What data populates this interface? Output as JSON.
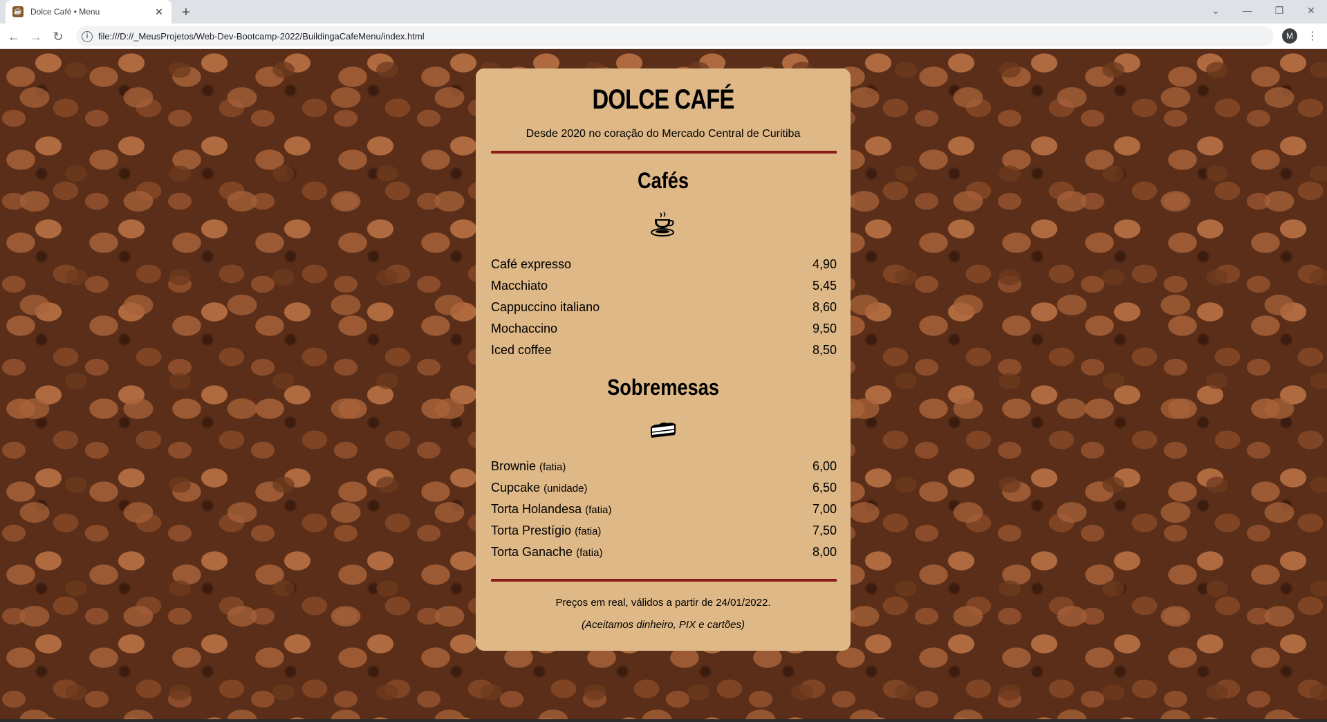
{
  "browser": {
    "tab_title": "Dolce Café • Menu",
    "url": "file:///D://_MeusProjetos/Web-Dev-Bootcamp-2022/BuildingaCafeMenu/index.html",
    "avatar_letter": "M"
  },
  "menu": {
    "title": "DOLCE CAFÉ",
    "tagline": "Desde 2020 no coração do Mercado Central de Curitiba",
    "sections": [
      {
        "title": "Cafés",
        "icon": "coffee-cup-icon",
        "items": [
          {
            "name": "Café expresso",
            "note": "",
            "price": "4,90"
          },
          {
            "name": "Macchiato",
            "note": "",
            "price": "5,45"
          },
          {
            "name": "Cappuccino italiano",
            "note": "",
            "price": "8,60"
          },
          {
            "name": "Mochaccino",
            "note": "",
            "price": "9,50"
          },
          {
            "name": "Iced coffee",
            "note": "",
            "price": "8,50"
          }
        ]
      },
      {
        "title": "Sobremesas",
        "icon": "pie-slice-icon",
        "items": [
          {
            "name": "Brownie",
            "note": "(fatia)",
            "price": "6,00"
          },
          {
            "name": "Cupcake",
            "note": "(unidade)",
            "price": "6,50"
          },
          {
            "name": "Torta Holandesa",
            "note": "(fatia)",
            "price": "7,00"
          },
          {
            "name": "Torta Prestígio",
            "note": "(fatia)",
            "price": "7,50"
          },
          {
            "name": "Torta Ganache",
            "note": "(fatia)",
            "price": "8,00"
          }
        ]
      }
    ],
    "footer_line1": "Preços em real, válidos a partir de 24/01/2022.",
    "footer_line2": "(Aceitamos dinheiro, PIX e cartões)"
  },
  "colors": {
    "card": "#deb887",
    "divider": "#8b1a1a"
  }
}
